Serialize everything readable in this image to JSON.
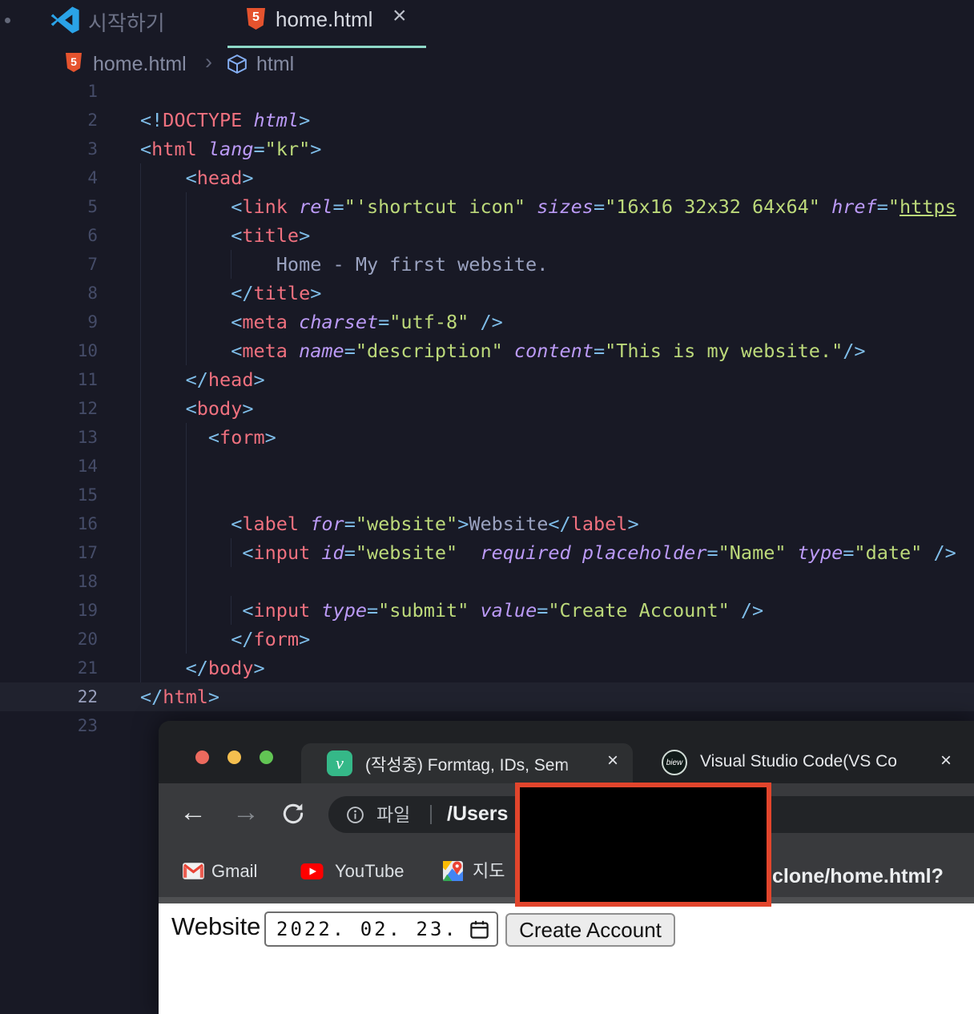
{
  "colors": {
    "accent_tab_underline": "#8ed8c8",
    "redaction_border": "#e2452c",
    "traffic_red": "#ec6a5e",
    "traffic_yellow": "#f5bf4f",
    "traffic_green": "#62c554",
    "velog_green": "#35b888",
    "html5_orange": "#e5532e"
  },
  "vscode": {
    "tabs": {
      "start_label": "시작하기",
      "home_label": "home.html",
      "close_glyph": "×"
    },
    "breadcrumb": {
      "file": "home.html",
      "chevron": "›",
      "symbol": "html"
    },
    "code": {
      "lines": [
        {
          "n": 1,
          "i": 0,
          "g": [],
          "t": []
        },
        {
          "n": 2,
          "i": 0,
          "g": [],
          "t": [
            [
              "p",
              "<!"
            ],
            [
              "t",
              "DOCTYPE"
            ],
            [
              "a",
              " html"
            ],
            [
              "p",
              ">"
            ]
          ]
        },
        {
          "n": 3,
          "i": 0,
          "g": [],
          "t": [
            [
              "p",
              "<"
            ],
            [
              "t",
              "html"
            ],
            [
              "a",
              " lang"
            ],
            [
              "p",
              "="
            ],
            [
              "v",
              "\"kr\""
            ],
            [
              "p",
              ">"
            ]
          ]
        },
        {
          "n": 4,
          "i": 4,
          "g": [
            0
          ],
          "t": [
            [
              "p",
              "<"
            ],
            [
              "t",
              "head"
            ],
            [
              "p",
              ">"
            ]
          ]
        },
        {
          "n": 5,
          "i": 8,
          "g": [
            0,
            4
          ],
          "t": [
            [
              "p",
              "<"
            ],
            [
              "t",
              "link"
            ],
            [
              "a",
              " rel"
            ],
            [
              "p",
              "="
            ],
            [
              "v",
              "\"'shortcut icon\""
            ],
            [
              "a",
              " sizes"
            ],
            [
              "p",
              "="
            ],
            [
              "v",
              "\"16x16 32x32 64x64\""
            ],
            [
              "a",
              " href"
            ],
            [
              "p",
              "="
            ],
            [
              "v",
              "\""
            ],
            [
              "u",
              "https"
            ]
          ]
        },
        {
          "n": 6,
          "i": 8,
          "g": [
            0,
            4
          ],
          "t": [
            [
              "p",
              "<"
            ],
            [
              "t",
              "title"
            ],
            [
              "p",
              ">"
            ]
          ]
        },
        {
          "n": 7,
          "i": 12,
          "g": [
            0,
            4,
            8
          ],
          "t": [
            [
              "x",
              "Home - My first website."
            ]
          ]
        },
        {
          "n": 8,
          "i": 8,
          "g": [
            0,
            4
          ],
          "t": [
            [
              "p",
              "</"
            ],
            [
              "t",
              "title"
            ],
            [
              "p",
              ">"
            ]
          ]
        },
        {
          "n": 9,
          "i": 8,
          "g": [
            0,
            4
          ],
          "t": [
            [
              "p",
              "<"
            ],
            [
              "t",
              "meta"
            ],
            [
              "a",
              " charset"
            ],
            [
              "p",
              "="
            ],
            [
              "v",
              "\"utf-8\""
            ],
            [
              "p",
              " />"
            ]
          ]
        },
        {
          "n": 10,
          "i": 8,
          "g": [
            0,
            4
          ],
          "t": [
            [
              "p",
              "<"
            ],
            [
              "t",
              "meta"
            ],
            [
              "a",
              " name"
            ],
            [
              "p",
              "="
            ],
            [
              "v",
              "\"description\""
            ],
            [
              "a",
              " content"
            ],
            [
              "p",
              "="
            ],
            [
              "v",
              "\"This is my website.\""
            ],
            [
              "p",
              "/>"
            ]
          ]
        },
        {
          "n": 11,
          "i": 4,
          "g": [
            0
          ],
          "t": [
            [
              "p",
              "</"
            ],
            [
              "t",
              "head"
            ],
            [
              "p",
              ">"
            ]
          ]
        },
        {
          "n": 12,
          "i": 4,
          "g": [
            0
          ],
          "t": [
            [
              "p",
              "<"
            ],
            [
              "t",
              "body"
            ],
            [
              "p",
              ">"
            ]
          ]
        },
        {
          "n": 13,
          "i": 6,
          "g": [
            0,
            4
          ],
          "t": [
            [
              "p",
              "<"
            ],
            [
              "t",
              "form"
            ],
            [
              "p",
              ">"
            ]
          ]
        },
        {
          "n": 14,
          "i": 0,
          "g": [
            0,
            4
          ],
          "t": []
        },
        {
          "n": 15,
          "i": 0,
          "g": [
            0,
            4
          ],
          "t": []
        },
        {
          "n": 16,
          "i": 8,
          "g": [
            0,
            4
          ],
          "t": [
            [
              "p",
              "<"
            ],
            [
              "t",
              "label"
            ],
            [
              "a",
              " for"
            ],
            [
              "p",
              "="
            ],
            [
              "v",
              "\"website\""
            ],
            [
              "p",
              ">"
            ],
            [
              "x",
              "Website"
            ],
            [
              "p",
              "</"
            ],
            [
              "t",
              "label"
            ],
            [
              "p",
              ">"
            ]
          ]
        },
        {
          "n": 17,
          "i": 9,
          "g": [
            0,
            4,
            8
          ],
          "t": [
            [
              "p",
              "<"
            ],
            [
              "t",
              "input"
            ],
            [
              "a",
              " id"
            ],
            [
              "p",
              "="
            ],
            [
              "v",
              "\"website\""
            ],
            [
              "a",
              "  required placeholder"
            ],
            [
              "p",
              "="
            ],
            [
              "v",
              "\"Name\""
            ],
            [
              "a",
              " type"
            ],
            [
              "p",
              "="
            ],
            [
              "v",
              "\"date\""
            ],
            [
              "p",
              " />"
            ]
          ]
        },
        {
          "n": 18,
          "i": 0,
          "g": [
            0,
            4
          ],
          "t": []
        },
        {
          "n": 19,
          "i": 9,
          "g": [
            0,
            4,
            8
          ],
          "t": [
            [
              "p",
              "<"
            ],
            [
              "t",
              "input"
            ],
            [
              "a",
              " type"
            ],
            [
              "p",
              "="
            ],
            [
              "v",
              "\"submit\""
            ],
            [
              "a",
              " value"
            ],
            [
              "p",
              "="
            ],
            [
              "v",
              "\"Create Account\""
            ],
            [
              "p",
              " />"
            ]
          ]
        },
        {
          "n": 20,
          "i": 8,
          "g": [
            0,
            4
          ],
          "t": [
            [
              "p",
              "</"
            ],
            [
              "t",
              "form"
            ],
            [
              "p",
              ">"
            ]
          ]
        },
        {
          "n": 21,
          "i": 4,
          "g": [
            0
          ],
          "t": [
            [
              "p",
              "</"
            ],
            [
              "t",
              "body"
            ],
            [
              "p",
              ">"
            ]
          ]
        },
        {
          "n": 22,
          "i": 0,
          "g": [],
          "active": true,
          "t": [
            [
              "p",
              "</"
            ],
            [
              "t",
              "html"
            ],
            [
              "p",
              ">"
            ]
          ]
        },
        {
          "n": 23,
          "i": 0,
          "g": [],
          "t": []
        }
      ]
    }
  },
  "browser": {
    "tab1": {
      "label": "(작성중) Formtag, IDs, Sem",
      "close": "×",
      "favicon_letter": "v"
    },
    "tab2": {
      "label": "Visual Studio Code(VS Co",
      "close": "×",
      "favicon_text": "biew"
    },
    "nav": {
      "back": "←",
      "forward": "→"
    },
    "address": {
      "scheme_label": "파일",
      "url_prefix": "/Users",
      "url_suffix": "clone/home.html?"
    },
    "bookmarks": [
      {
        "name": "Gmail"
      },
      {
        "name": "YouTube"
      },
      {
        "name": "지도"
      }
    ],
    "page": {
      "label": "Website",
      "date_value": "2022. 02. 23.",
      "button": "Create Account"
    }
  }
}
